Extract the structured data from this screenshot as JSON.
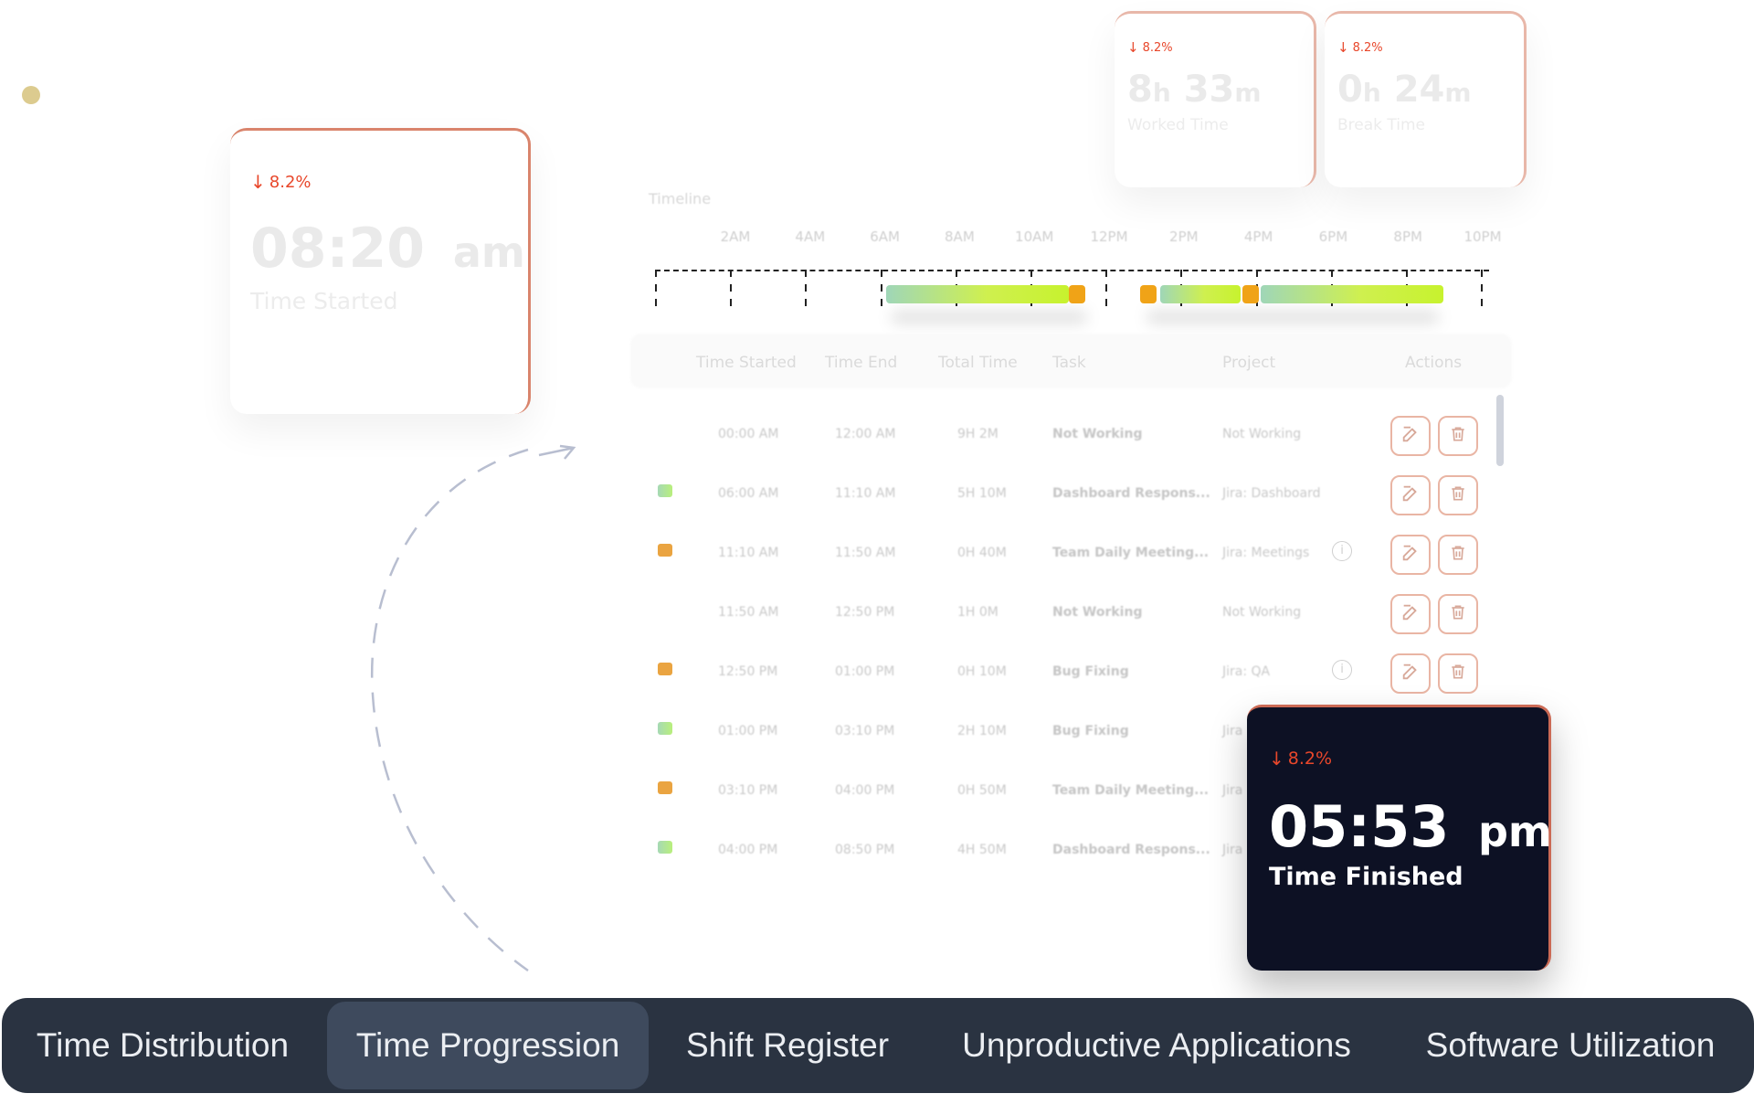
{
  "metrics": {
    "time_started": {
      "trend": "8.2%",
      "time": "08:20",
      "period": "am",
      "label": "Time Started"
    },
    "worked_time": {
      "trend": "8.2%",
      "hours": "8",
      "h_unit": "h",
      "minutes": "33",
      "m_unit": "m",
      "label": "Worked Time"
    },
    "break_time": {
      "trend": "8.2%",
      "hours": "0",
      "h_unit": "h",
      "minutes": "24",
      "m_unit": "m",
      "label": "Break Time"
    },
    "time_finished": {
      "trend": "8.2%",
      "time": "05:53",
      "period": "pm",
      "label": "Time Finished"
    }
  },
  "timeline": {
    "title": "Timeline",
    "hours": [
      "2AM",
      "4AM",
      "6AM",
      "8AM",
      "10AM",
      "12PM",
      "2PM",
      "4PM",
      "6PM",
      "8PM",
      "10PM"
    ]
  },
  "table": {
    "headers": [
      "Time Started",
      "Time End",
      "Total Time",
      "Task",
      "Project",
      "Actions"
    ],
    "rows": [
      {
        "start": "00:00 AM",
        "end": "12:00 AM",
        "total": "9H 2M",
        "task": "Not Working",
        "project": "Not Working",
        "swatch": "none",
        "info": false
      },
      {
        "start": "06:00 AM",
        "end": "11:10 AM",
        "total": "5H 10M",
        "task": "Dashboard Respons...",
        "project": "Jira: Dashboard",
        "swatch": "green",
        "info": false
      },
      {
        "start": "11:10 AM",
        "end": "11:50 AM",
        "total": "0H 40M",
        "task": "Team Daily Meeting...",
        "project": "Jira: Meetings",
        "swatch": "orange",
        "info": true
      },
      {
        "start": "11:50 AM",
        "end": "12:50 PM",
        "total": "1H 0M",
        "task": "Not Working",
        "project": "Not Working",
        "swatch": "none",
        "info": false
      },
      {
        "start": "12:50 PM",
        "end": "01:00 PM",
        "total": "0H 10M",
        "task": "Bug Fixing",
        "project": "Jira: QA",
        "swatch": "orange",
        "info": true
      },
      {
        "start": "01:00 PM",
        "end": "03:10 PM",
        "total": "2H 10M",
        "task": "Bug Fixing",
        "project": "Jira",
        "swatch": "green",
        "info": false
      },
      {
        "start": "03:10 PM",
        "end": "04:00 PM",
        "total": "0H 50M",
        "task": "Team Daily Meeting...",
        "project": "Jira",
        "swatch": "orange",
        "info": false
      },
      {
        "start": "04:00 PM",
        "end": "08:50 PM",
        "total": "4H 50M",
        "task": "Dashboard Respons...",
        "project": "Jira",
        "swatch": "green",
        "info": false
      }
    ]
  },
  "icons": {
    "trend": "arrow-down-icon",
    "edit": "edit-icon",
    "delete": "trash-icon",
    "info": "info-icon"
  },
  "colors": {
    "accent": "#e8472b",
    "dark_card": "#0d1124",
    "tabbar": "#2a3341",
    "active_tab": "#3e4a5d",
    "bar_green": "#c7f22e",
    "bar_orange": "#f0a317"
  },
  "tabs": [
    {
      "label": "Time Distribution",
      "active": false
    },
    {
      "label": "Time Progression",
      "active": true
    },
    {
      "label": "Shift Register",
      "active": false
    },
    {
      "label": "Unproductive Applications",
      "active": false
    },
    {
      "label": "Software Utilization",
      "active": false
    }
  ]
}
